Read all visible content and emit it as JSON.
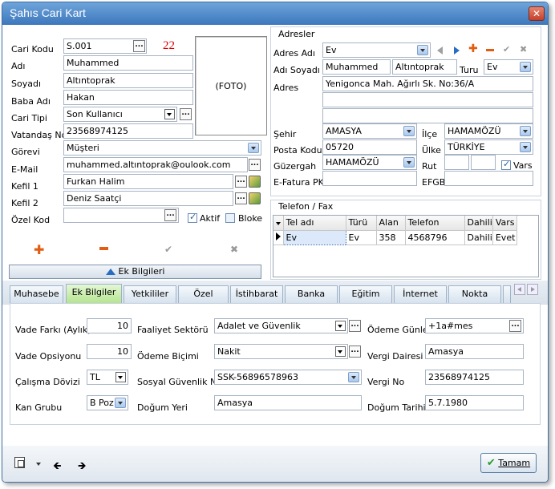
{
  "window": {
    "title": "Şahıs Cari Kart",
    "close_label": "✕"
  },
  "left": {
    "cari_kodu": {
      "label": "Cari Kodu",
      "value": "S.001",
      "count": "22"
    },
    "adi": {
      "label": "Adı",
      "value": "Muhammed"
    },
    "soyadi": {
      "label": "Soyadı",
      "value": "Altıntoprak"
    },
    "baba_adi": {
      "label": "Baba Adı",
      "value": "Hakan"
    },
    "cari_tipi": {
      "label": "Cari Tipi",
      "value": "Son Kullanıcı"
    },
    "vatandas_no": {
      "label": "Vatandaş No",
      "value": "23568974125"
    },
    "foto": "(FOTO)",
    "gorevi": {
      "label": "Görevi",
      "value": "Müşteri"
    },
    "email": {
      "label": "E-Mail",
      "value": "muhammed.altıntoprak@oulook.com"
    },
    "kefil1": {
      "label": "Kefil 1",
      "value": "Furkan Halim"
    },
    "kefil2": {
      "label": "Kefil 2",
      "value": "Deniz Saatçi"
    },
    "ozel_kod": {
      "label": "Özel Kod",
      "value": ""
    },
    "aktif": "Aktif",
    "bloke": "Bloke",
    "ek_bilgileri": "Ek Bilgileri"
  },
  "adresler": {
    "header": "Adresler",
    "adres_adi": {
      "label": "Adres Adı",
      "value": "Ev"
    },
    "adi_soyadi": {
      "label": "Adı Soyadı",
      "adi": "Muhammed",
      "soyadi": "Altıntoprak"
    },
    "turu": {
      "label": "Turu",
      "value": "Ev"
    },
    "adres": {
      "label": "Adres",
      "line1": "Yenigonca Mah. Ağırlı Sk. No:36/A",
      "line2": "",
      "line3": ""
    },
    "sehir": {
      "label": "Şehir",
      "value": "AMASYA"
    },
    "ilce": {
      "label": "İlçe",
      "value": "HAMAMÖZÜ"
    },
    "posta_kodu": {
      "label": "Posta Kodu",
      "value": "05720"
    },
    "ulke": {
      "label": "Ülke",
      "value": "TÜRKİYE"
    },
    "guzergah": {
      "label": "Güzergah",
      "value": "HAMAMÖZÜ"
    },
    "rut": {
      "label": "Rut",
      "value1": "",
      "value2": ""
    },
    "vars": "Vars",
    "efatura": {
      "label": "E-Fatura PK",
      "value": ""
    },
    "efgb": {
      "label": "EFGB",
      "value": ""
    }
  },
  "telefon": {
    "header": "Telefon / Fax",
    "columns": [
      "Tel adı",
      "Türü",
      "Alan",
      "Telefon",
      "Dahili",
      "Vars"
    ],
    "rows": [
      [
        "Ev",
        "Ev",
        "358",
        "4568796",
        "Dahili",
        "Evet"
      ]
    ]
  },
  "tabs": [
    "Muhasebe",
    "Ek Bilgiler",
    "Yetkililer",
    "Özel Günler",
    "İstihbarat",
    "Banka",
    "Eğitim",
    "İnternet",
    "Nokta"
  ],
  "ek": {
    "vade_farki": {
      "label": "Vade Farkı (Aylık)",
      "value": "10"
    },
    "vade_opsiyonu": {
      "label": "Vade Opsiyonu",
      "value": "10"
    },
    "calisma_dovizi": {
      "label": "Çalışma Dövizi",
      "value": "TL"
    },
    "kan_grubu": {
      "label": "Kan Grubu",
      "value": "B Poz"
    },
    "faaliyet": {
      "label": "Faaliyet Sektörü",
      "value": "Adalet ve Güvenlik"
    },
    "odeme_bicimi": {
      "label": "Ödeme Biçimi",
      "value": "Nakit"
    },
    "sgn": {
      "label": "Sosyal Güvenlik No",
      "value": "SSK-56896578963"
    },
    "dogum_yeri": {
      "label": "Doğum Yeri",
      "value": "Amasya"
    },
    "odeme_gunleri": {
      "label": "Ödeme Günleri",
      "value": "+1a#mes"
    },
    "vergi_dairesi": {
      "label": "Vergi Dairesi",
      "value": "Amasya"
    },
    "vergi_no": {
      "label": "Vergi No",
      "value": "23568974125"
    },
    "dogum_tarihi": {
      "label": "Doğum Tarihi",
      "value": "5.7.1980"
    }
  },
  "footer": {
    "tamam": "Tamam"
  }
}
